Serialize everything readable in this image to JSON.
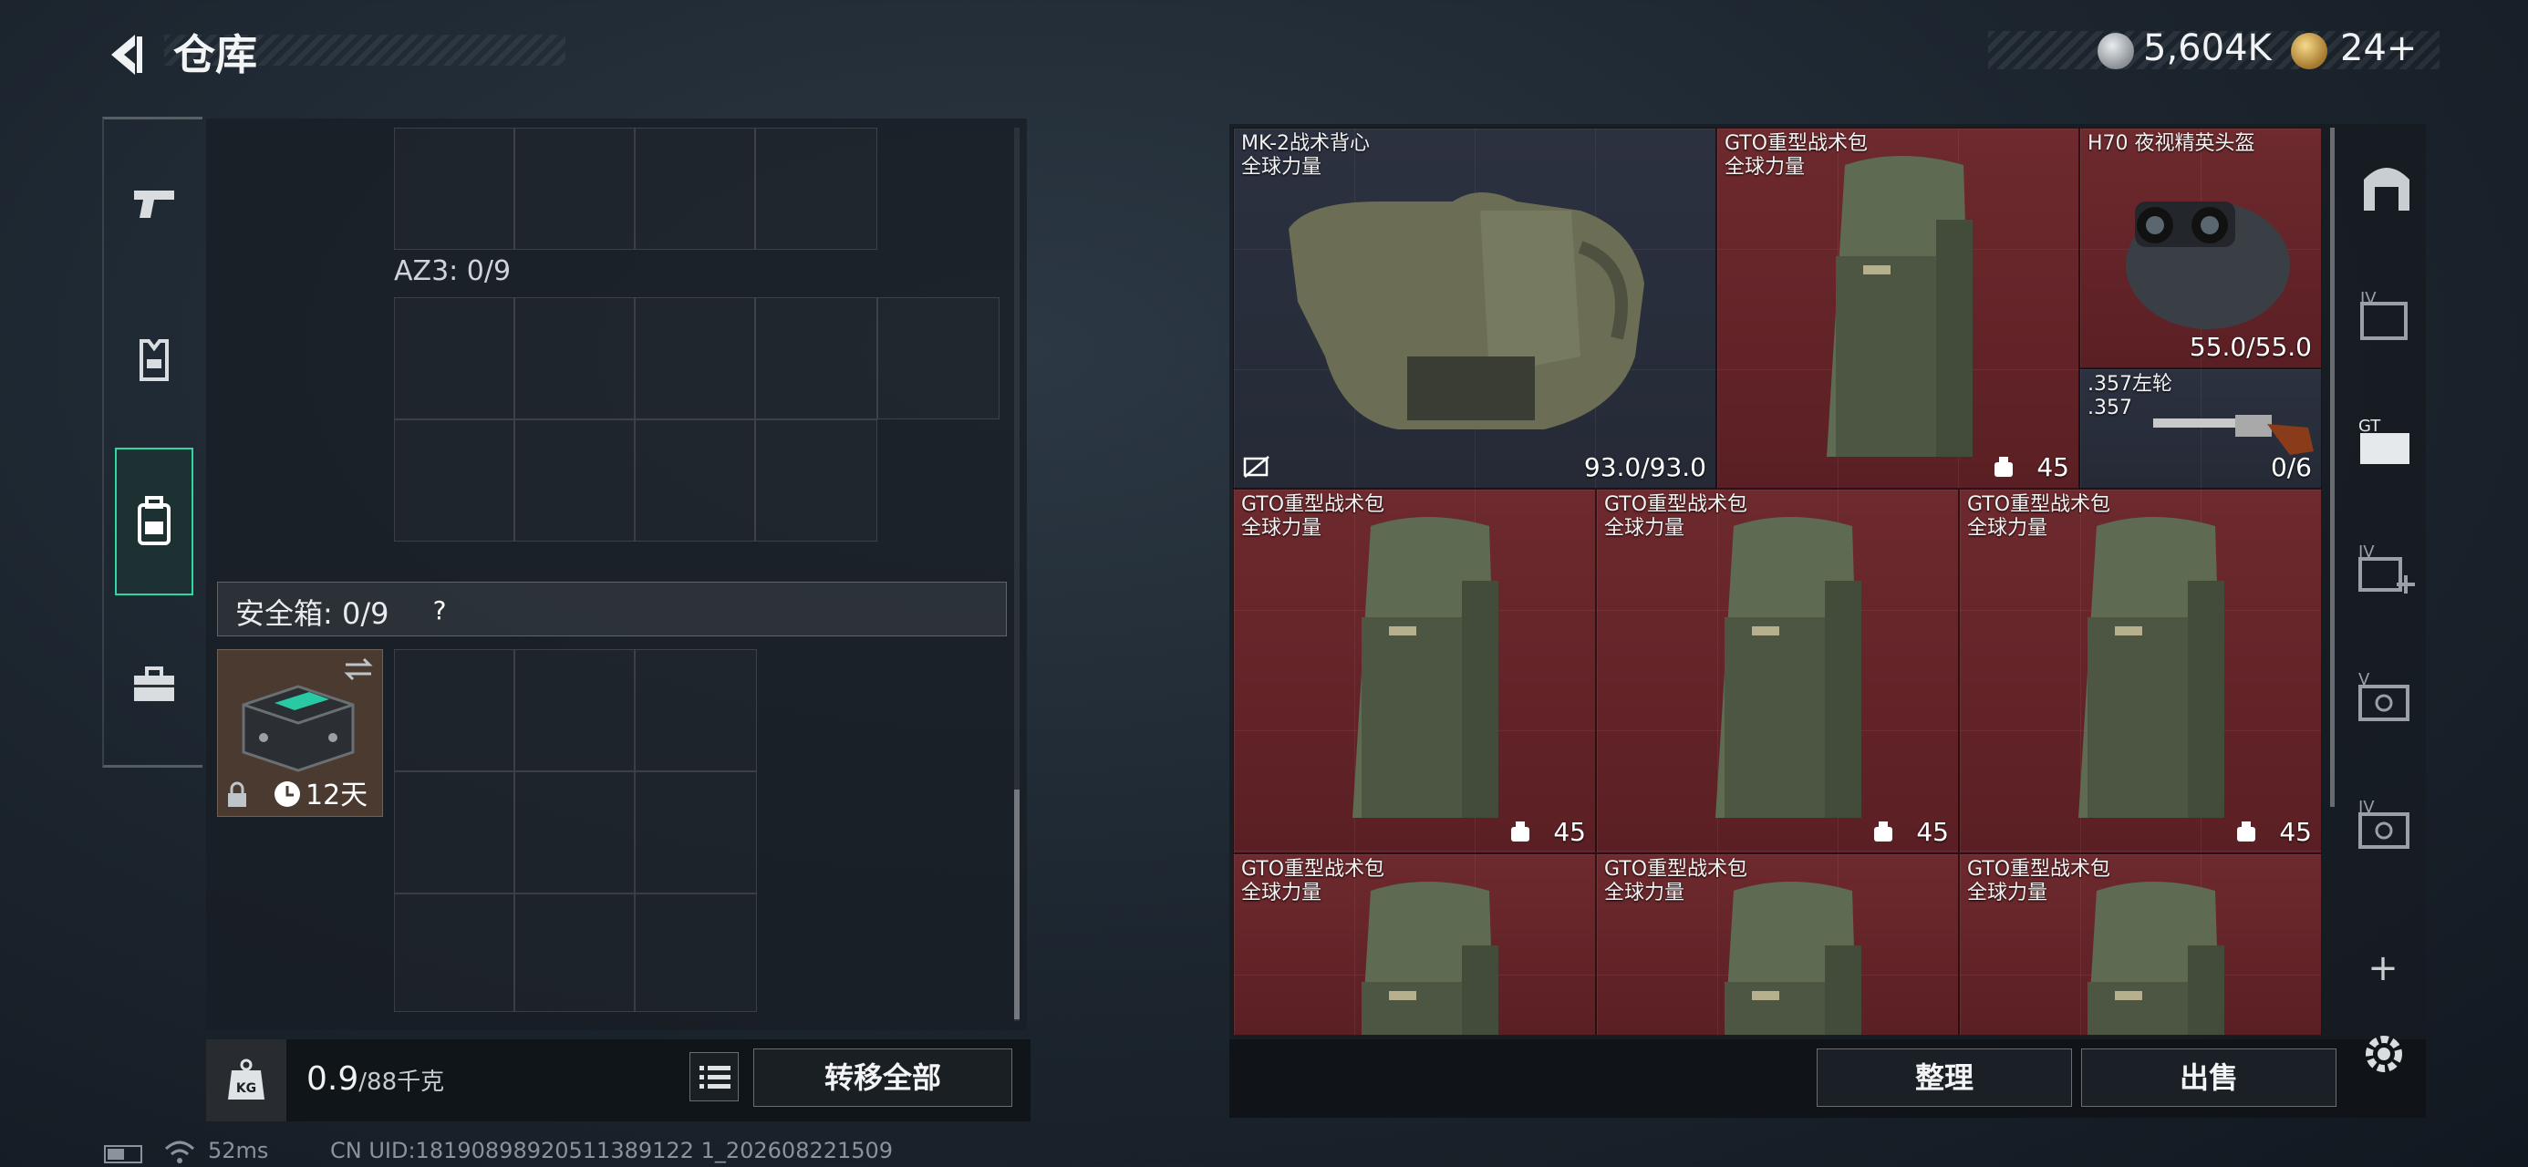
{
  "header": {
    "title": "仓库",
    "currency_silver": "5,604K",
    "currency_gold": "24+"
  },
  "left_nav": [
    {
      "icon": "pistol-icon"
    },
    {
      "icon": "vest-icon"
    },
    {
      "icon": "backpack-icon",
      "active": true
    },
    {
      "icon": "toolbox-icon"
    }
  ],
  "left_panel": {
    "az3_label": "AZ3: 0/9",
    "safe_label": "安全箱: 0/9",
    "safe_help": "?",
    "safe_item_timer": "12天",
    "weight_value": "0.9",
    "weight_max": "/88千克",
    "transfer_label": "转移全部"
  },
  "inventory": [
    {
      "name": "MK-2战术背心",
      "sub": "全球力量",
      "value": "93.0/93.0",
      "color": "blue",
      "kind": "vest"
    },
    {
      "name": "GTO重型战术包",
      "sub": "全球力量",
      "value": "45",
      "color": "red",
      "kind": "backpack"
    },
    {
      "name": "H70 夜视精英头盔",
      "sub": "",
      "value": "55.0/55.0",
      "color": "red",
      "kind": "helmet"
    },
    {
      "name": ".357左轮",
      "sub": ".357",
      "value": "0/6",
      "color": "blue",
      "kind": "revolver"
    },
    {
      "name": "GTO重型战术包",
      "sub": "全球力量",
      "value": "45",
      "color": "red",
      "kind": "backpack"
    },
    {
      "name": "GTO重型战术包",
      "sub": "全球力量",
      "value": "45",
      "color": "red",
      "kind": "backpack"
    },
    {
      "name": "GTO重型战术包",
      "sub": "全球力量",
      "value": "45",
      "color": "red",
      "kind": "backpack"
    },
    {
      "name": "GTO重型战术包",
      "sub": "全球力量",
      "value": "",
      "color": "red",
      "kind": "backpack"
    },
    {
      "name": "GTO重型战术包",
      "sub": "全球力量",
      "value": "",
      "color": "red",
      "kind": "backpack"
    },
    {
      "name": "GTO重型战术包",
      "sub": "全球力量",
      "value": "",
      "color": "red",
      "kind": "backpack"
    }
  ],
  "right_actions": {
    "sort_label": "整理",
    "sell_label": "出售"
  },
  "right_nav": [
    {
      "icon": "home-storage-icon",
      "label": ""
    },
    {
      "icon": "storage-iv-icon",
      "label": "IV"
    },
    {
      "icon": "storage-gt-icon",
      "label": "GT"
    },
    {
      "icon": "storage-iv-add-icon",
      "label": "IV"
    },
    {
      "icon": "storage-v-icon",
      "label": "V"
    },
    {
      "icon": "storage-iv-b-icon",
      "label": "IV"
    }
  ],
  "status_bar": {
    "ping": "52ms",
    "uid": "CN UID:18190898920511389122 1_202608221509"
  },
  "colors": {
    "accent": "#2fd7a3",
    "item_red": "#6e2a2e",
    "item_blue": "#2c3140"
  }
}
